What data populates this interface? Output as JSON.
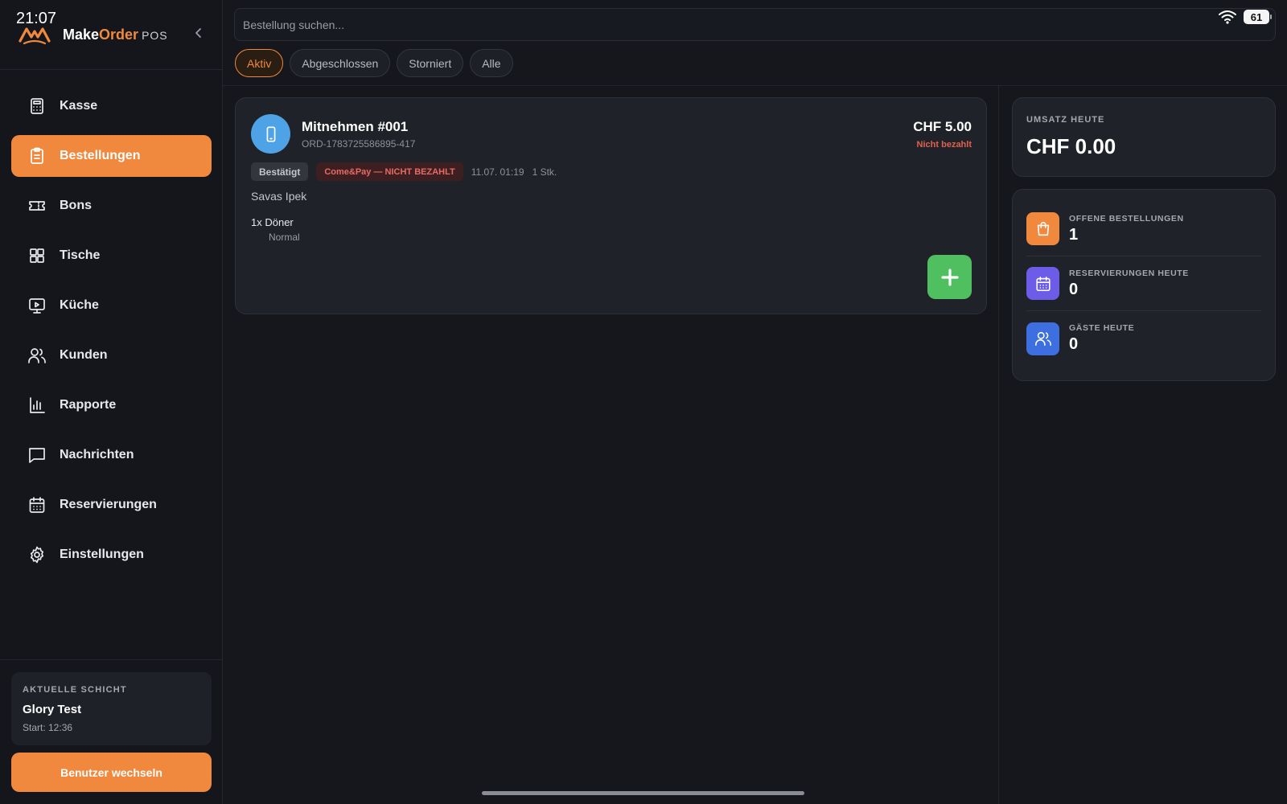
{
  "status_bar": {
    "time": "21:07",
    "battery": "61"
  },
  "brand": {
    "name_part1": "Make",
    "name_part2": "Order",
    "suffix": "POS"
  },
  "sidebar": {
    "items": [
      {
        "label": "Kasse",
        "icon": "calculator-icon",
        "active": false
      },
      {
        "label": "Bestellungen",
        "icon": "clipboard-icon",
        "active": true
      },
      {
        "label": "Bons",
        "icon": "ticket-icon",
        "active": false
      },
      {
        "label": "Tische",
        "icon": "grid-icon",
        "active": false
      },
      {
        "label": "Küche",
        "icon": "monitor-icon",
        "active": false
      },
      {
        "label": "Kunden",
        "icon": "users-icon",
        "active": false
      },
      {
        "label": "Rapporte",
        "icon": "bar-chart-icon",
        "active": false
      },
      {
        "label": "Nachrichten",
        "icon": "message-icon",
        "active": false
      },
      {
        "label": "Reservierungen",
        "icon": "calendar-icon",
        "active": false
      },
      {
        "label": "Einstellungen",
        "icon": "gear-icon",
        "active": false
      }
    ],
    "shift": {
      "label": "AKTUELLE SCHICHT",
      "name": "Glory Test",
      "start": "Start: 12:36"
    },
    "switch_user_label": "Benutzer wechseln"
  },
  "search": {
    "placeholder": "Bestellung suchen..."
  },
  "tabs": [
    {
      "label": "Aktiv",
      "active": true
    },
    {
      "label": "Abgeschlossen",
      "active": false
    },
    {
      "label": "Storniert",
      "active": false
    },
    {
      "label": "Alle",
      "active": false
    }
  ],
  "order": {
    "title": "Mitnehmen #001",
    "id": "ORD-1783725586895-417",
    "total": "CHF 5.00",
    "payment_status": "Nicht bezahlt",
    "status_badge": "Bestätigt",
    "payment_badge": "Come&Pay — NICHT BEZAHLT",
    "datetime": "11.07. 01:19",
    "quantity": "1 Stk.",
    "customer": "Savas Ipek",
    "item": "1x Döner",
    "variant": "Normal"
  },
  "revenue": {
    "label": "UMSATZ HEUTE",
    "value": "CHF 0.00"
  },
  "stats": [
    {
      "label": "OFFENE BESTELLUNGEN",
      "value": "1",
      "color": "#f0883e",
      "icon": "shopping-bag-icon"
    },
    {
      "label": "RESERVIERUNGEN HEUTE",
      "value": "0",
      "color": "#6c5ce7",
      "icon": "calendar-icon"
    },
    {
      "label": "GÄSTE HEUTE",
      "value": "0",
      "color": "#3d6fe0",
      "icon": "users-icon"
    }
  ],
  "colors": {
    "accent": "#f0883e",
    "background": "#15171d",
    "card": "#1f2228",
    "success": "#4fbf5f",
    "danger": "#e0614e"
  }
}
